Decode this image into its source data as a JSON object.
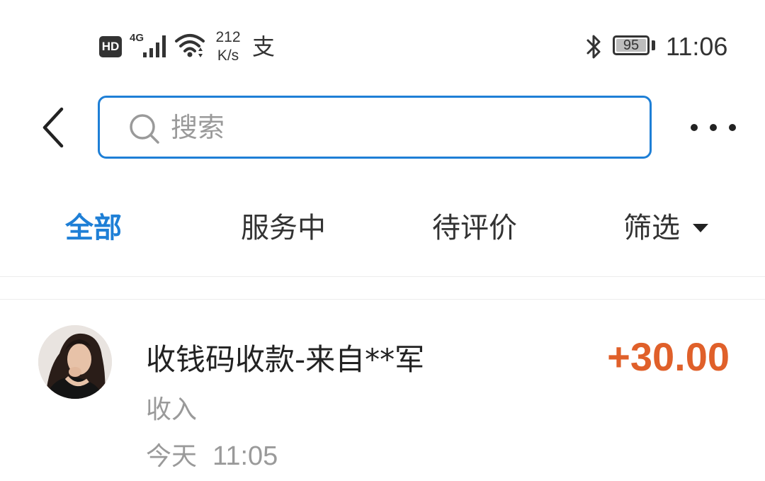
{
  "status_bar": {
    "hd_label": "HD",
    "network_label": "4G",
    "speed_value": "212",
    "speed_unit": "K/s",
    "alipay_glyph": "支",
    "battery_level": "95",
    "time": "11:06",
    "icons": [
      "signal-icon",
      "wifi-icon",
      "alipay-icon",
      "bluetooth-icon",
      "battery-icon"
    ]
  },
  "header": {
    "search_placeholder": "搜索",
    "back_icon": "chevron-left-icon",
    "more_icon": "more-dots-icon"
  },
  "tabs": [
    {
      "label": "全部",
      "active": true
    },
    {
      "label": "服务中",
      "active": false
    },
    {
      "label": "待评价",
      "active": false
    },
    {
      "label": "筛选",
      "active": false,
      "icon": "caret-down-icon"
    }
  ],
  "transactions": [
    {
      "title": "收钱码收款-来自**军",
      "amount": "+30.00",
      "category": "收入",
      "date": "今天",
      "time": "11:05"
    }
  ],
  "colors": {
    "accent": "#1e7fd6",
    "amount": "#e0602a",
    "secondary_text": "#9a9a9a"
  }
}
